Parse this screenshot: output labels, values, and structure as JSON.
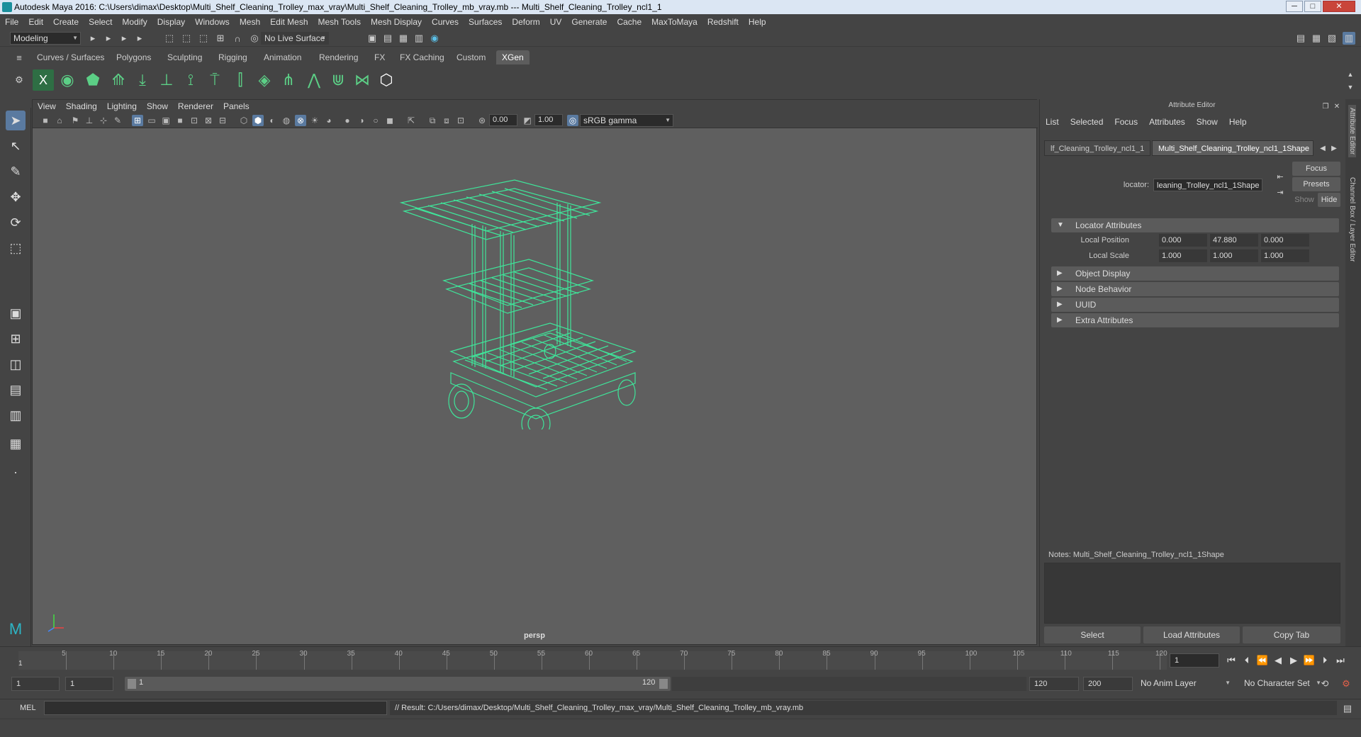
{
  "window": {
    "title": "Autodesk Maya 2016: C:\\Users\\dimax\\Desktop\\Multi_Shelf_Cleaning_Trolley_max_vray\\Multi_Shelf_Cleaning_Trolley_mb_vray.mb   ---   Multi_Shelf_Cleaning_Trolley_ncl1_1",
    "minimize": "─",
    "maximize": "□",
    "close": "✕"
  },
  "menubar": [
    "File",
    "Edit",
    "Create",
    "Select",
    "Modify",
    "Display",
    "Windows",
    "Mesh",
    "Edit Mesh",
    "Mesh Tools",
    "Mesh Display",
    "Curves",
    "Surfaces",
    "Deform",
    "UV",
    "Generate",
    "Cache",
    "MaxToMaya",
    "Redshift",
    "Help"
  ],
  "statusline": {
    "mode": "Modeling",
    "live_surface": "No Live Surface"
  },
  "shelf": {
    "tabs": [
      "Curves / Surfaces",
      "Polygons",
      "Sculpting",
      "Rigging",
      "Animation",
      "Rendering",
      "FX",
      "FX Caching",
      "Custom",
      "XGen"
    ],
    "active_tab": "XGen"
  },
  "viewport": {
    "menu": [
      "View",
      "Shading",
      "Lighting",
      "Show",
      "Renderer",
      "Panels"
    ],
    "exposure": "0.00",
    "gamma": "1.00",
    "color_space": "sRGB gamma",
    "camera": "persp",
    "wire_color": "#3fe59a"
  },
  "attribute_editor": {
    "header": "Attribute Editor",
    "menu": [
      "List",
      "Selected",
      "Focus",
      "Attributes",
      "Show",
      "Help"
    ],
    "tabs": [
      "lf_Cleaning_Trolley_ncl1_1",
      "Multi_Shelf_Cleaning_Trolley_ncl1_1Shape"
    ],
    "active_tab": 1,
    "locator_label": "locator:",
    "locator_value": "leaning_Trolley_ncl1_1Shape",
    "focus_btn": "Focus",
    "presets_btn": "Presets",
    "show_btn": "Show",
    "hide_btn": "Hide",
    "sections": {
      "locator": "Locator Attributes",
      "object_display": "Object Display",
      "node_behavior": "Node Behavior",
      "uuid": "UUID",
      "extra": "Extra Attributes"
    },
    "local_position": {
      "label": "Local Position",
      "values": [
        "0.000",
        "47.880",
        "0.000"
      ]
    },
    "local_scale": {
      "label": "Local Scale",
      "values": [
        "1.000",
        "1.000",
        "1.000"
      ]
    },
    "notes_label": "Notes:",
    "notes_value": "Multi_Shelf_Cleaning_Trolley_ncl1_1Shape",
    "buttons": {
      "select": "Select",
      "load": "Load Attributes",
      "copy": "Copy Tab"
    }
  },
  "right_strip": {
    "attr_editor": "Attribute Editor",
    "channel_box": "Channel Box / Layer Editor"
  },
  "timeline": {
    "ticks": [
      "5",
      "10",
      "15",
      "20",
      "25",
      "30",
      "35",
      "40",
      "45",
      "50",
      "55",
      "60",
      "65",
      "70",
      "75",
      "80",
      "85",
      "90",
      "95",
      "100",
      "105",
      "110",
      "115",
      "120"
    ],
    "start_marker": "1",
    "current_frame": "1"
  },
  "range": {
    "start": "1",
    "playback_start": "1",
    "slider_start": "1",
    "slider_end": "120",
    "playback_end": "120",
    "end": "200",
    "anim_layer": "No Anim Layer",
    "char_set": "No Character Set"
  },
  "command": {
    "lang": "MEL",
    "result": "// Result: C:/Users/dimax/Desktop/Multi_Shelf_Cleaning_Trolley_max_vray/Multi_Shelf_Cleaning_Trolley_mb_vray.mb"
  }
}
